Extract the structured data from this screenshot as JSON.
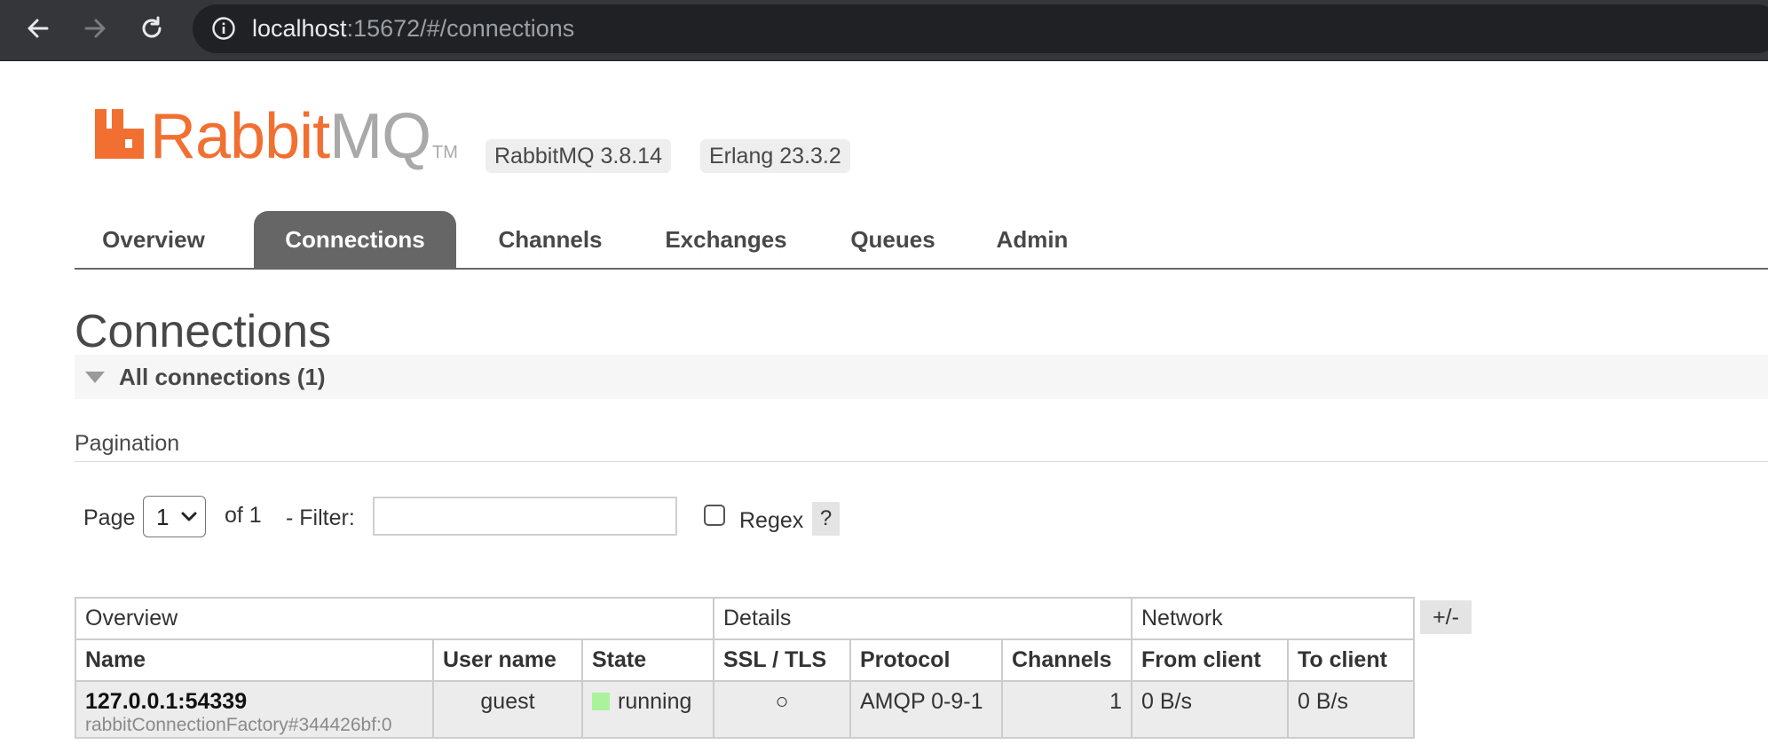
{
  "browser": {
    "url_host": "localhost",
    "url_rest": ":15672/#/connections"
  },
  "header": {
    "logo_primary": "Rabbit",
    "logo_secondary": "MQ",
    "logo_tm": "TM",
    "rabbitmq_version": "RabbitMQ 3.8.14",
    "erlang_version": "Erlang 23.3.2"
  },
  "tabs": [
    {
      "label": "Overview",
      "active": false
    },
    {
      "label": "Connections",
      "active": true
    },
    {
      "label": "Channels",
      "active": false
    },
    {
      "label": "Exchanges",
      "active": false
    },
    {
      "label": "Queues",
      "active": false
    },
    {
      "label": "Admin",
      "active": false
    }
  ],
  "page_title": "Connections",
  "section": {
    "title": "All connections (1)"
  },
  "pagination": {
    "label": "Pagination",
    "page_label": "Page",
    "page_value": "1",
    "of_label": "of 1",
    "filter_label": "- Filter:",
    "filter_value": "",
    "regex_label": "Regex",
    "regex_checked": false,
    "help_label": "?"
  },
  "table": {
    "groups": [
      "Overview",
      "Details",
      "Network"
    ],
    "columns": [
      "Name",
      "User name",
      "State",
      "SSL / TLS",
      "Protocol",
      "Channels",
      "From client",
      "To client"
    ],
    "rows": [
      {
        "name": "127.0.0.1:54339",
        "name_sub": "rabbitConnectionFactory#344426bf:0",
        "user": "guest",
        "state": "running",
        "ssl": "○",
        "protocol": "AMQP 0-9-1",
        "channels": "1",
        "from_client": "0 B/s",
        "to_client": "0 B/s"
      }
    ],
    "toggle_label": "+/-"
  },
  "colors": {
    "brand_orange": "#f26f32",
    "tab_active": "#666666",
    "state_running": "#aaf29b"
  }
}
